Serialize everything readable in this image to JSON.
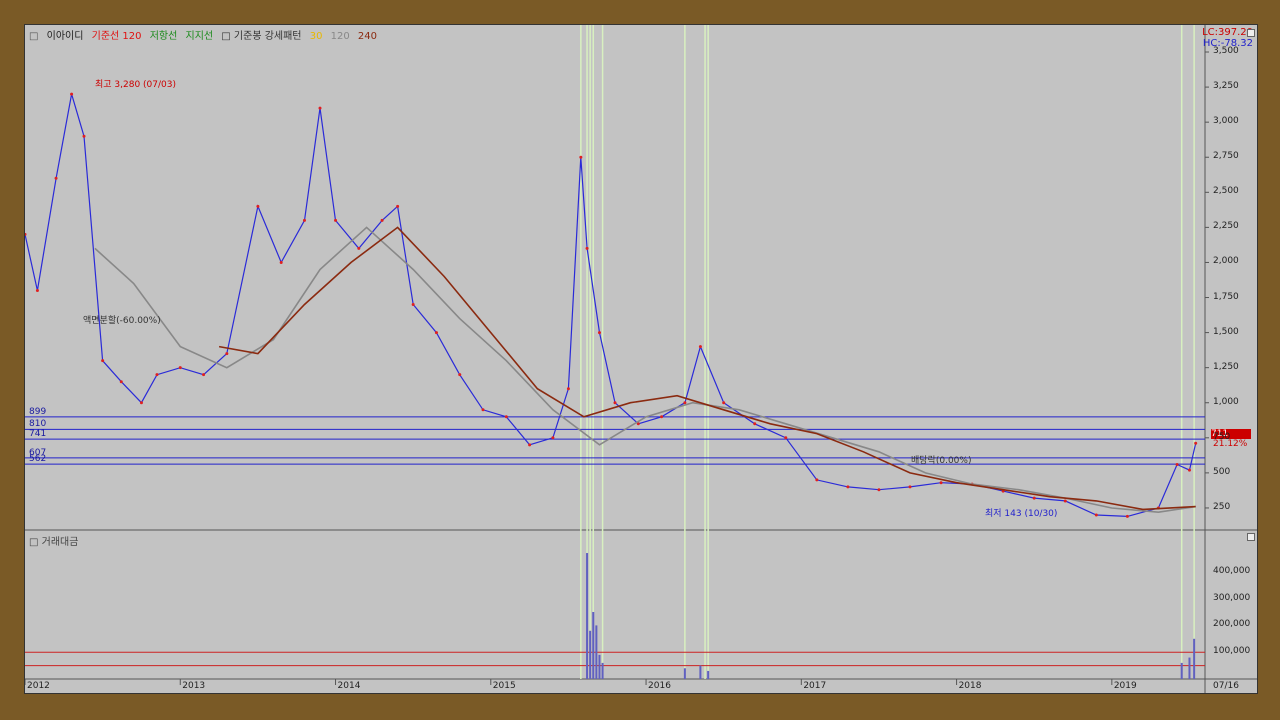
{
  "legend": {
    "square": "□",
    "name": "이아이디",
    "base_line": "기준선 120",
    "resistance": "저항선",
    "support": "지지선",
    "base_candle": "□ 기준봉 강세패턴",
    "ma_a": "30",
    "ma_b": "120",
    "ma_c": "240"
  },
  "readouts": {
    "lc": "LC:397.20",
    "hc": "HC:-78.32"
  },
  "last_price_tag": "711",
  "last_pct": "21.12%",
  "annotations": {
    "high": "최고 3,280 (07/03)",
    "low": "최저 143 (10/30)",
    "split": "액면분할(-60.00%)",
    "dividend": "배당락(0.00%)"
  },
  "volume_label": "거래대금",
  "colors": {
    "price": "#2a2ad8",
    "candle_up": "#e02020",
    "ma_short": "#e8b800",
    "ma_mid": "#888888",
    "ma_long": "#8b2a10",
    "band": "#1a8a1a",
    "base_line": "#e01010",
    "hline": "#2222cc",
    "volume": "#6060c0",
    "highlight": "#d8f0c0"
  },
  "chart_data": {
    "type": "line",
    "title": "",
    "x_ticks": [
      "2012",
      "2013",
      "2014",
      "2015",
      "2016",
      "2017",
      "2018",
      "2019",
      "07/16"
    ],
    "y_ticks": [
      "3,500",
      "3,250",
      "3,000",
      "2,750",
      "2,500",
      "2,250",
      "2,000",
      "1,750",
      "1,500",
      "1,250",
      "1,000",
      "750",
      "500",
      "250"
    ],
    "y_tick_values": [
      3500,
      3250,
      3000,
      2750,
      2500,
      2250,
      2000,
      1750,
      1500,
      1250,
      1000,
      750,
      500,
      250
    ],
    "ylim": [
      100,
      3550
    ],
    "horizontal_levels": [
      899,
      810,
      741,
      607,
      562
    ],
    "horizontal_level_labels": [
      "899",
      "810",
      "741",
      "607",
      "562"
    ],
    "series": [
      {
        "name": "price",
        "x": [
          2012.0,
          2012.08,
          2012.2,
          2012.3,
          2012.38,
          2012.5,
          2012.62,
          2012.75,
          2012.85,
          2013.0,
          2013.15,
          2013.3,
          2013.5,
          2013.65,
          2013.8,
          2013.9,
          2014.0,
          2014.15,
          2014.3,
          2014.4,
          2014.5,
          2014.65,
          2014.8,
          2014.95,
          2015.1,
          2015.25,
          2015.4,
          2015.5,
          2015.58,
          2015.62,
          2015.7,
          2015.8,
          2015.95,
          2016.1,
          2016.25,
          2016.35,
          2016.5,
          2016.7,
          2016.9,
          2017.1,
          2017.3,
          2017.5,
          2017.7,
          2017.9,
          2018.1,
          2018.3,
          2018.5,
          2018.7,
          2018.9,
          2019.1,
          2019.3,
          2019.42,
          2019.5,
          2019.54
        ],
        "y": [
          2200,
          1800,
          2600,
          3200,
          2900,
          1300,
          1150,
          1000,
          1200,
          1250,
          1200,
          1350,
          2400,
          2000,
          2300,
          3100,
          2300,
          2100,
          2300,
          2400,
          1700,
          1500,
          1200,
          950,
          900,
          700,
          750,
          1100,
          2750,
          2100,
          1500,
          1000,
          850,
          900,
          1000,
          1400,
          1000,
          850,
          750,
          450,
          400,
          380,
          400,
          430,
          420,
          370,
          320,
          300,
          200,
          190,
          250,
          560,
          520,
          711
        ]
      },
      {
        "name": "120",
        "x": [
          2012.45,
          2012.7,
          2013.0,
          2013.3,
          2013.6,
          2013.9,
          2014.2,
          2014.5,
          2014.8,
          2015.1,
          2015.4,
          2015.7,
          2016.0,
          2016.3,
          2016.6,
          2016.9,
          2017.2,
          2017.5,
          2017.8,
          2018.1,
          2018.4,
          2018.7,
          2019.0,
          2019.3,
          2019.54
        ],
        "y": [
          2100,
          1850,
          1400,
          1250,
          1450,
          1950,
          2250,
          1950,
          1600,
          1300,
          950,
          700,
          900,
          1000,
          950,
          850,
          750,
          650,
          500,
          420,
          380,
          320,
          250,
          220,
          260
        ]
      },
      {
        "name": "240",
        "x": [
          2013.25,
          2013.5,
          2013.8,
          2014.1,
          2014.4,
          2014.7,
          2015.0,
          2015.3,
          2015.6,
          2015.9,
          2016.2,
          2016.5,
          2016.8,
          2017.1,
          2017.4,
          2017.7,
          2018.0,
          2018.3,
          2018.6,
          2018.9,
          2019.2,
          2019.54
        ],
        "y": [
          1400,
          1350,
          1700,
          2000,
          2250,
          1900,
          1500,
          1100,
          900,
          1000,
          1050,
          950,
          850,
          780,
          650,
          500,
          430,
          380,
          330,
          300,
          240,
          260
        ]
      }
    ],
    "volume": {
      "y_ticks": [
        "400,000",
        "300,000",
        "200,000",
        "100,000"
      ],
      "y_tick_values": [
        400000,
        300000,
        200000,
        100000
      ],
      "ylim": [
        0,
        500000
      ],
      "levels": [
        100000,
        50000
      ],
      "x": [
        2015.62,
        2015.64,
        2015.66,
        2015.68,
        2015.7,
        2015.72,
        2016.25,
        2016.35,
        2016.4,
        2019.45,
        2019.5,
        2019.53
      ],
      "values": [
        470000,
        180000,
        250000,
        200000,
        90000,
        60000,
        40000,
        50000,
        30000,
        60000,
        80000,
        150000
      ]
    }
  }
}
